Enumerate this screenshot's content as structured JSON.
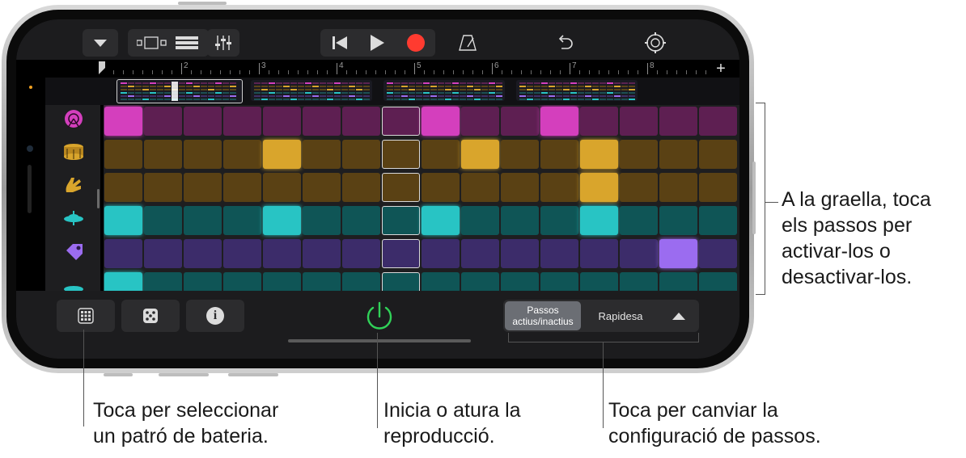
{
  "toolbar": {
    "icons": [
      "chevron-down-icon",
      "tracks-view-icon",
      "list-view-icon",
      "mixer-icon",
      "rewind-icon",
      "play-icon",
      "record-icon",
      "metronome-icon",
      "undo-icon",
      "settings-icon"
    ]
  },
  "ruler": {
    "bars": [
      "2",
      "3",
      "4",
      "5",
      "6",
      "7",
      "8"
    ],
    "add_label": "+"
  },
  "tracks": [
    {
      "name": "kick-drum",
      "icon": "kick-drum-icon",
      "color": "#d43fbd"
    },
    {
      "name": "snare-drum",
      "icon": "snare-drum-icon",
      "color": "#d9a52c"
    },
    {
      "name": "clap",
      "icon": "clap-icon",
      "color": "#d9a52c"
    },
    {
      "name": "hi-hat",
      "icon": "hi-hat-icon",
      "color": "#28c4c4"
    },
    {
      "name": "tambourine",
      "icon": "tambourine-icon",
      "color": "#9b6cf0"
    },
    {
      "name": "cymbal",
      "icon": "cymbal-icon",
      "color": "#28c4c4"
    }
  ],
  "steps": {
    "count_per_row": 16,
    "playhead_column": 7,
    "active": [
      [
        0,
        8,
        11
      ],
      [
        4,
        9,
        12
      ],
      [
        12
      ],
      [
        0,
        4,
        8,
        12
      ],
      [
        14
      ],
      [
        0
      ]
    ]
  },
  "bottom": {
    "segment": {
      "active_line1": "Passos",
      "active_line2": "actius/inactius",
      "other": "Rapidesa"
    },
    "info_glyph": "i"
  },
  "callouts": {
    "grid_line1": "A la graella, toca",
    "grid_line2": "els passos per",
    "grid_line3": "activar-los o",
    "grid_line4": "desactivar-los.",
    "pattern_line1": "Toca per seleccionar",
    "pattern_line2": "un patró de bateria.",
    "play_line1": "Inicia o atura la",
    "play_line2": "reproducció.",
    "steps_line1": "Toca per canviar la",
    "steps_line2": "configuració de passos."
  },
  "colors": {
    "accent_record": "#ff3b30",
    "power_green": "#30d158",
    "magenta": "#d43fbd",
    "amber": "#d9a52c",
    "teal": "#28c4c4",
    "purple": "#9b6cf0"
  }
}
